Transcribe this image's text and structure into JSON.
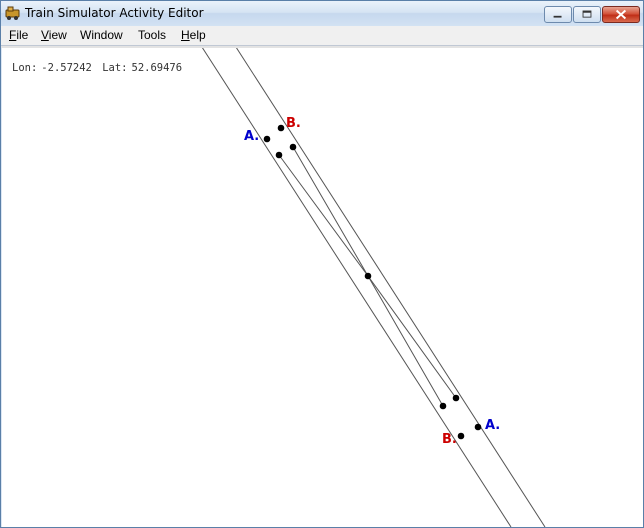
{
  "window": {
    "title": "Train Simulator Activity Editor",
    "icon": "train-editor-app-icon"
  },
  "menubar": {
    "items": [
      {
        "key": "F",
        "rest": "ile",
        "underlined": true
      },
      {
        "key": "V",
        "rest": "iew",
        "underlined": true
      },
      {
        "key": "",
        "rest": "Window",
        "underlined": false
      },
      {
        "key": "",
        "rest": "Tools",
        "underlined": false
      },
      {
        "key": "H",
        "rest": "elp",
        "underlined": true
      }
    ]
  },
  "status": {
    "lon_label": "Lon:",
    "lon_value": "-2.57242",
    "lat_label": "Lat:",
    "lat_value": "52.69476"
  },
  "markers": {
    "a_label": "A.",
    "b_label": "B.",
    "a_color": "#0000cc",
    "b_color": "#cc0000"
  },
  "colors": {
    "line": "#555555",
    "node": "#000000"
  }
}
